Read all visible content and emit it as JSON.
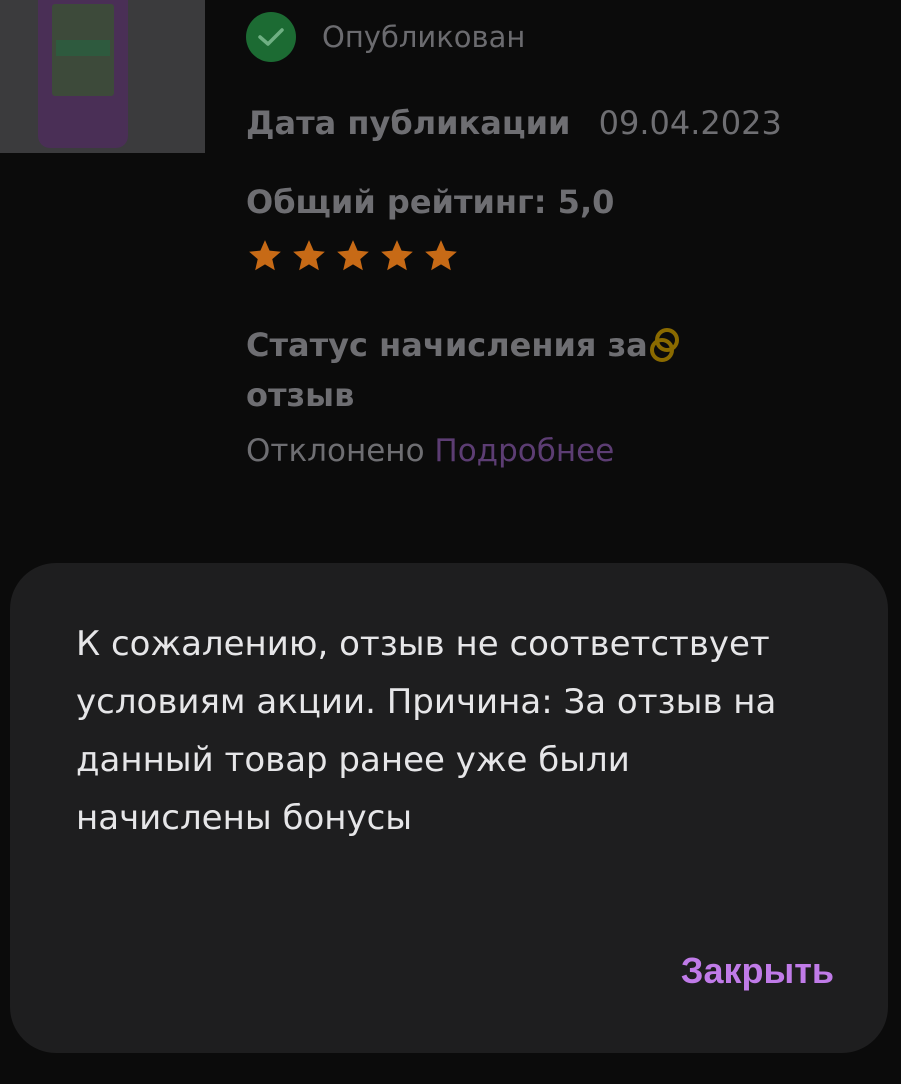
{
  "review": {
    "status": "Опубликован",
    "pub_label": "Дата публикации",
    "pub_date": "09.04.2023",
    "rating_label": "Общий рейтинг: 5,0",
    "rating_value": 5,
    "bonus_status_label": "Статус начисления за отзыв",
    "rejected": "Отклонено",
    "details_link": "Подробнее"
  },
  "dialog": {
    "message": "К сожалению, отзыв не соответствует условиям акции. Причина: За отзыв на данный товар ранее уже были начислены бонусы",
    "close_label": "Закрыть"
  },
  "colors": {
    "accent": "#c07be8",
    "star": "#c76a16",
    "check": "#1c6b33",
    "coin": "#8a6a00"
  }
}
